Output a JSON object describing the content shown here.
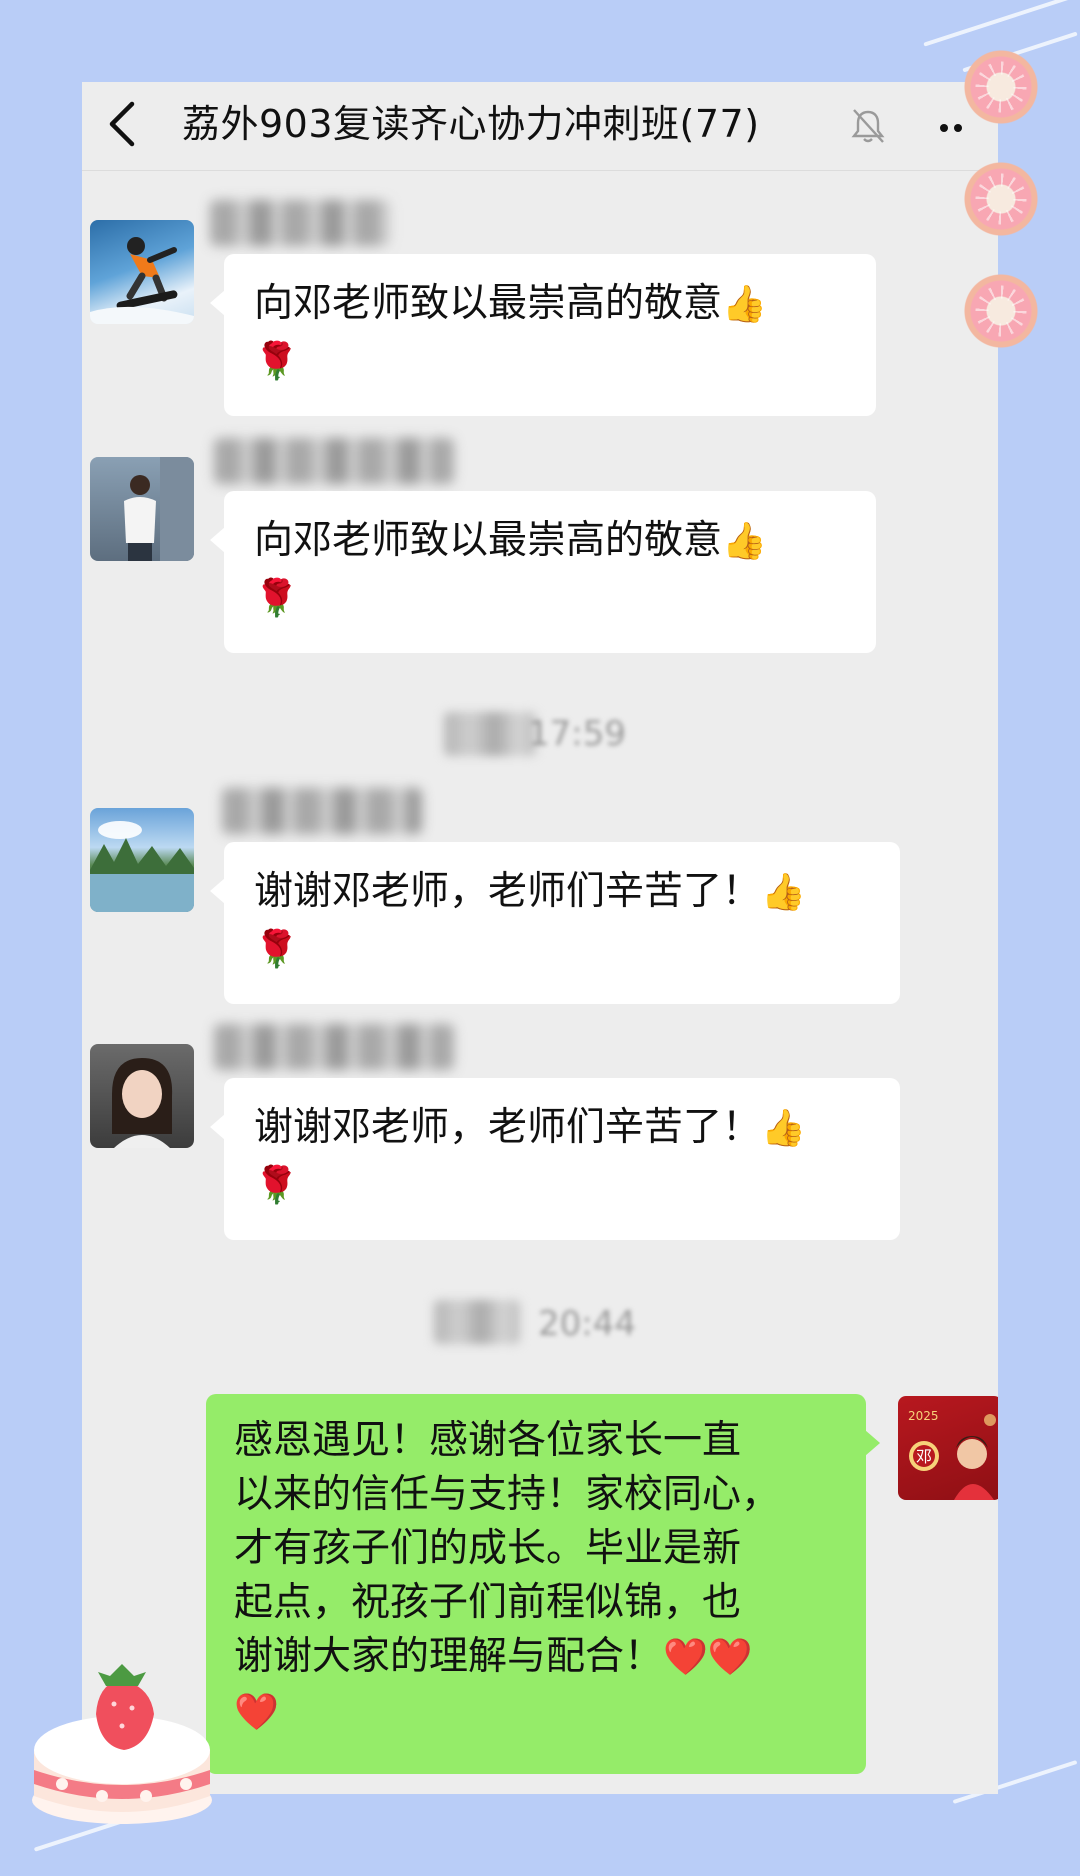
{
  "header": {
    "title": "荔外903复读齐心协力冲刺班(77)",
    "back_icon": "chevron-left-icon",
    "mute_icon": "bell-muted-icon",
    "more_icon": "more-dots-icon"
  },
  "messages": [
    {
      "text": "向邓老师致以最崇高的敬意",
      "emoji_thumb": "👍",
      "emoji_rose": "🌹"
    },
    {
      "text": "向邓老师致以最崇高的敬意",
      "emoji_thumb": "👍",
      "emoji_rose": "🌹"
    },
    {
      "text": "谢谢邓老师，老师们辛苦了！",
      "emoji_thumb": "👍",
      "emoji_rose": "🌹"
    },
    {
      "text": "谢谢邓老师，老师们辛苦了！",
      "emoji_thumb": "👍",
      "emoji_rose": "🌹"
    }
  ],
  "timestamps": [
    "17:59",
    "20:44"
  ],
  "my_message": {
    "lines": [
      "感恩遇见！感谢各位家长一直",
      "以来的信任与支持！家校同心，",
      "才有孩子们的成长。毕业是新",
      "起点，祝孩子们前程似锦，也",
      "谢谢大家的理解与配合！"
    ],
    "hearts_line1": "❤️❤️",
    "hearts_line2": "❤️"
  },
  "my_avatar": {
    "year": "2025",
    "char": "邓"
  },
  "colors": {
    "background": "#b9cdf7",
    "chat_bg": "#ededed",
    "my_bubble": "#95ec69",
    "other_bubble": "#ffffff"
  }
}
